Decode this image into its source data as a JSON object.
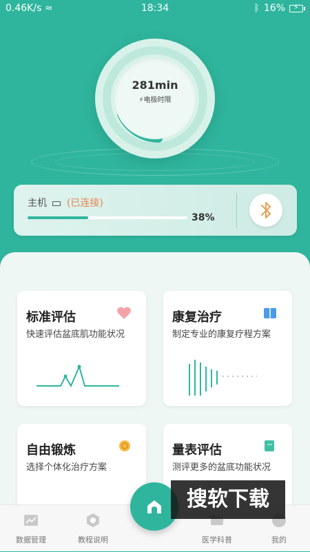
{
  "status_bar": {
    "network_speed": "0.46K/s",
    "time": "18:34",
    "battery": "16%"
  },
  "timer": {
    "value": "281min",
    "label": "电极时限"
  },
  "device": {
    "name": "主机",
    "status": "(已连接)",
    "progress_percent": 38,
    "progress_label": "38%"
  },
  "cards": [
    {
      "title": "标准评估",
      "desc": "快速评估盆底肌功能状况",
      "icon": "heart-icon"
    },
    {
      "title": "康复治疗",
      "desc": "制定专业的康复疗程方案",
      "icon": "book-icon"
    },
    {
      "title": "自由锻炼",
      "desc": "选择个体化治疗方案",
      "icon": "snail-icon"
    },
    {
      "title": "量表评估",
      "desc": "测评更多的盆底功能状况",
      "icon": "scroll-icon"
    }
  ],
  "nav": [
    {
      "label": "数据管理",
      "icon": "chart-icon"
    },
    {
      "label": "教程说明",
      "icon": "hexagon-icon"
    },
    {
      "label": "",
      "icon": "home-icon"
    },
    {
      "label": "医学科普",
      "icon": "book-open-icon"
    },
    {
      "label": "我的",
      "icon": "user-icon"
    }
  ],
  "watermark": "搜软下载",
  "colors": {
    "brand": "#2fb59d",
    "accent": "#e8864f"
  }
}
